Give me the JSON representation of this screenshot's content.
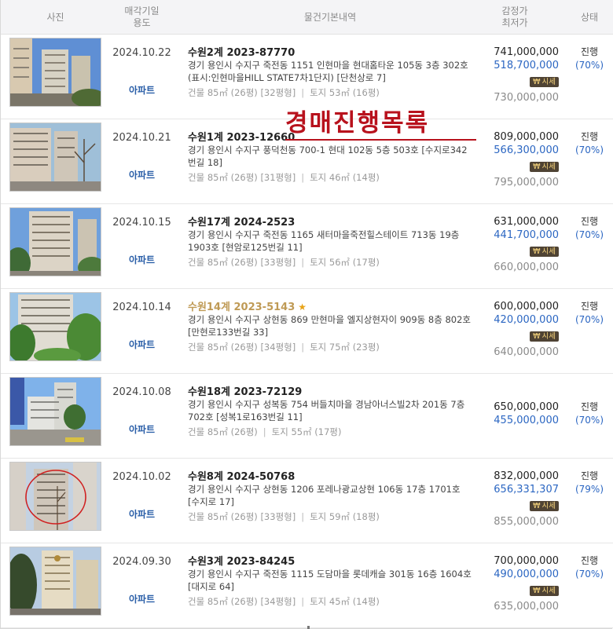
{
  "header": {
    "photo": "사진",
    "date_line1": "매각기일",
    "date_line2": "용도",
    "info": "물건기본내역",
    "price_line1": "감정가",
    "price_line2": "최저가",
    "status": "상태"
  },
  "overlay_title": "경매진행목록",
  "badge_icon": "₩",
  "badge_label": "시세",
  "area_sep": "|",
  "rows": [
    {
      "date": "2024.10.22",
      "use": "아파트",
      "title": "수원2계 2023-87770",
      "addr": "경기 용인시 수지구 죽전동 1151 인현마을 현대홈타운 105동 3층 302호 (표시:인현마을HILL STATE7차1단지) [단천상로 7]",
      "building": "건물 85㎡ (26평) [32평형]",
      "land": "토지 53㎡ (16평)",
      "appraisal": "741,000,000",
      "minimum": "518,700,000",
      "previous": "730,000,000",
      "status": "진행",
      "rate": "(70%)"
    },
    {
      "date": "2024.10.21",
      "use": "아파트",
      "title": "수원1계 2023-12660",
      "addr": "경기 용인시 수지구 풍덕천동 700-1 현대 102동 5층 503호 [수지로342번길 18]",
      "building": "건물 85㎡ (26평) [31평형]",
      "land": "토지 46㎡ (14평)",
      "appraisal": "809,000,000",
      "minimum": "566,300,000",
      "previous": "795,000,000",
      "status": "진행",
      "rate": "(70%)"
    },
    {
      "date": "2024.10.15",
      "use": "아파트",
      "title": "수원17계 2024-2523",
      "addr": "경기 용인시 수지구 죽전동 1165 새터마을죽전힐스테이트 713동 19층 1903호 [현암로125번길 11]",
      "building": "건물 85㎡ (26평) [33평형]",
      "land": "토지 56㎡ (17평)",
      "appraisal": "631,000,000",
      "minimum": "441,700,000",
      "previous": "660,000,000",
      "status": "진행",
      "rate": "(70%)"
    },
    {
      "date": "2024.10.14",
      "use": "아파트",
      "title": "수원14계 2023-5143",
      "addr": "경기 용인시 수지구 상현동 869 만현마을 엘지상현자이 909동 8층 802호 [만현로133번길 33]",
      "building": "건물 85㎡ (26평) [34평형]",
      "land": "토지 75㎡ (23평)",
      "appraisal": "600,000,000",
      "minimum": "420,000,000",
      "previous": "640,000,000",
      "status": "진행",
      "rate": "(70%)"
    },
    {
      "date": "2024.10.08",
      "use": "아파트",
      "title": "수원18계 2023-72129",
      "addr": "경기 용인시 수지구 성복동 754 버들치마을 경남아너스빌2차 201동 7층 702호 [성복1로163번길 11]",
      "building": "건물 85㎡ (26평)",
      "land": "토지 55㎡ (17평)",
      "appraisal": "650,000,000",
      "minimum": "455,000,000",
      "previous": "",
      "status": "진행",
      "rate": "(70%)"
    },
    {
      "date": "2024.10.02",
      "use": "아파트",
      "title": "수원8계 2024-50768",
      "addr": "경기 용인시 수지구 상현동 1206 포레나광교상현 106동 17층 1701호 [수지로 17]",
      "building": "건물 85㎡ (26평) [33평형]",
      "land": "토지 59㎡ (18평)",
      "appraisal": "832,000,000",
      "minimum": "656,331,307",
      "previous": "855,000,000",
      "status": "진행",
      "rate": "(79%)"
    },
    {
      "date": "2024.09.30",
      "use": "아파트",
      "title": "수원3계 2023-84245",
      "addr": "경기 용인시 수지구 죽전동 1115 도담마을 롯데캐슬 301동 16층 1604호 [대지로 64]",
      "building": "건물 85㎡ (26평) [34평형]",
      "land": "토지 45㎡ (14평)",
      "appraisal": "700,000,000",
      "minimum": "490,000,000",
      "previous": "635,000,000",
      "status": "진행",
      "rate": "(70%)"
    }
  ]
}
